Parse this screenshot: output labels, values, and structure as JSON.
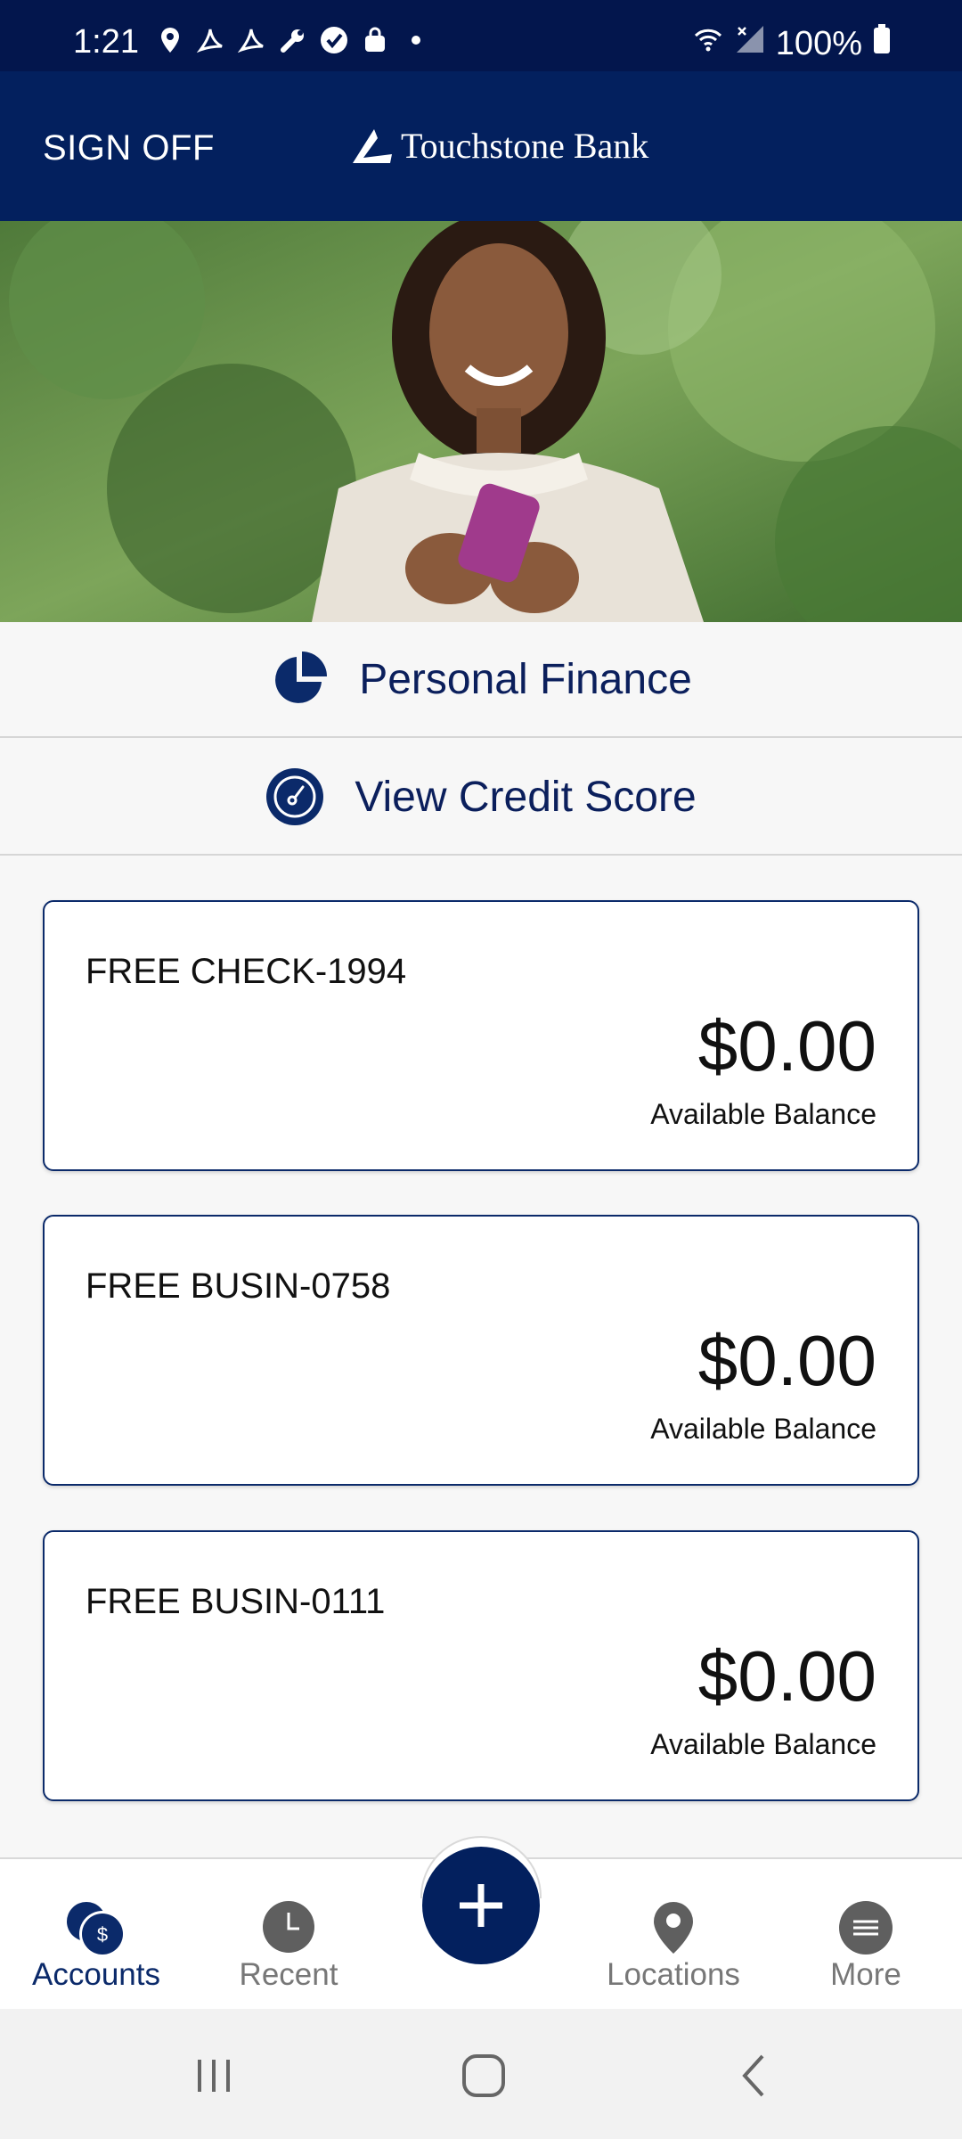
{
  "status_bar": {
    "time": "1:21",
    "battery": "100%"
  },
  "header": {
    "sign_off_label": "SIGN OFF",
    "brand_name": "Touchstone Bank"
  },
  "quick_links": [
    {
      "label": "Personal Finance",
      "icon": "pie-chart-icon"
    },
    {
      "label": "View Credit Score",
      "icon": "speedometer-icon"
    }
  ],
  "accounts": [
    {
      "name": "FREE CHECK-1994",
      "balance": "$0.00",
      "balance_label": "Available Balance"
    },
    {
      "name": "FREE BUSIN-0758",
      "balance": "$0.00",
      "balance_label": "Available Balance"
    },
    {
      "name": "FREE BUSIN-0111",
      "balance": "$0.00",
      "balance_label": "Available Balance"
    }
  ],
  "bottom_nav": {
    "items": [
      {
        "label": "Accounts",
        "icon": "accounts-icon",
        "active": true
      },
      {
        "label": "Recent",
        "icon": "clock-icon",
        "active": false
      },
      {
        "label": "Locations",
        "icon": "location-pin-icon",
        "active": false
      },
      {
        "label": "More",
        "icon": "menu-icon",
        "active": false
      }
    ],
    "fab_icon": "plus-icon"
  },
  "colors": {
    "navy": "#03205e",
    "status_bar": "#03164d",
    "card_border": "#0b2a6a",
    "inactive": "#777777"
  }
}
